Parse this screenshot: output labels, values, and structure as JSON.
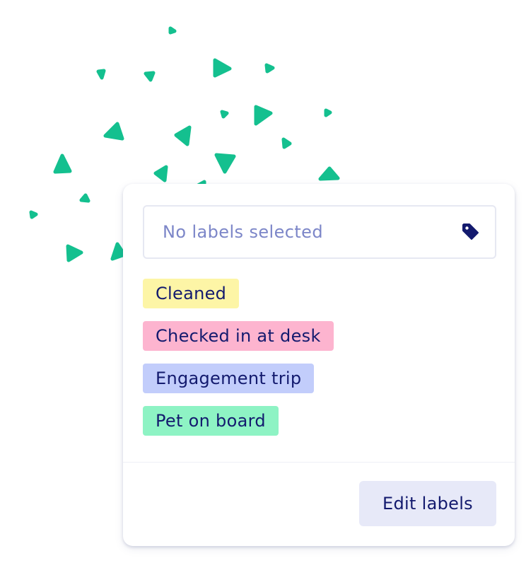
{
  "label_picker": {
    "placeholder": "No labels selected",
    "icon": "tag-icon",
    "icon_color": "#131a6e"
  },
  "labels": [
    {
      "text": "Cleaned",
      "color": "#fdf5a6"
    },
    {
      "text": "Checked in at desk",
      "color": "#fdb4cf"
    },
    {
      "text": "Engagement trip",
      "color": "#c2cdfb"
    },
    {
      "text": "Pet on board",
      "color": "#8ef3c4"
    }
  ],
  "footer": {
    "edit_label": "Edit labels"
  },
  "colors": {
    "accent": "#14c08f",
    "text": "#131a6e",
    "placeholder": "#7c86c8"
  }
}
